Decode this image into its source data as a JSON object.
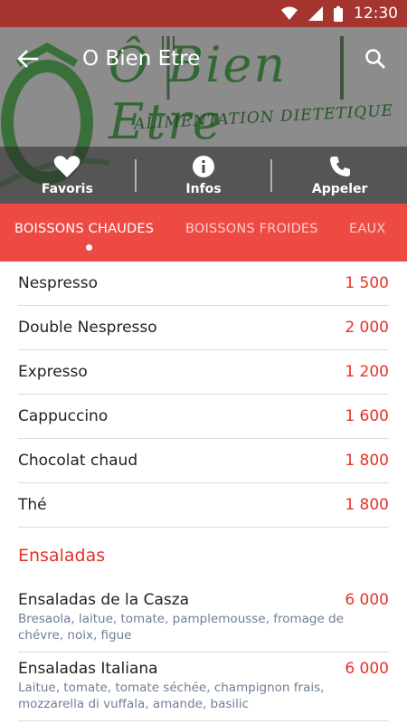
{
  "status_bar": {
    "time": "12:30",
    "icons": [
      "wifi-icon",
      "signal-icon",
      "battery-icon"
    ]
  },
  "header": {
    "title": "O Bien Etre",
    "back_icon": "arrow-left-icon",
    "search_icon": "search-icon"
  },
  "logo": {
    "main_text": "Ô Bien Etre",
    "sub_text": "ALIMENTATION DIETETIQUE"
  },
  "actions": [
    {
      "label": "Favoris",
      "icon": "heart-icon"
    },
    {
      "label": "Infos",
      "icon": "info-icon"
    },
    {
      "label": "Appeler",
      "icon": "phone-icon"
    }
  ],
  "tabs": [
    {
      "label": "BOISSONS CHAUDES",
      "active": true
    },
    {
      "label": "BOISSONS FROIDES",
      "active": false
    },
    {
      "label": "EAUX",
      "active": false
    }
  ],
  "menu": {
    "items": [
      {
        "name": "Nespresso",
        "price": "1 500"
      },
      {
        "name": "Double Nespresso",
        "price": "2 000"
      },
      {
        "name": "Expresso",
        "price": "1 200"
      },
      {
        "name": "Cappuccino",
        "price": "1 600"
      },
      {
        "name": "Chocolat chaud",
        "price": "1 800"
      },
      {
        "name": "Thé",
        "price": "1 800"
      }
    ],
    "section": {
      "title": "Ensaladas",
      "items": [
        {
          "name": "Ensaladas de la Casza",
          "price": "6 000",
          "desc_line1": "Bresaola, laitue, tomate, pamplemousse, fromage de",
          "desc_line2": "chévre, noix, figue"
        },
        {
          "name": "Ensaladas Italiana",
          "price": "6 000",
          "desc_line1": "Laitue, tomate, tomate séchée, champignon frais,",
          "desc_line2": "mozzarella di vuffala, amande, basilic"
        }
      ]
    }
  },
  "colors": {
    "status_bar": "#a5362f",
    "accent": "#ed4a43",
    "price": "#e5322a",
    "description": "#6f7f96"
  }
}
